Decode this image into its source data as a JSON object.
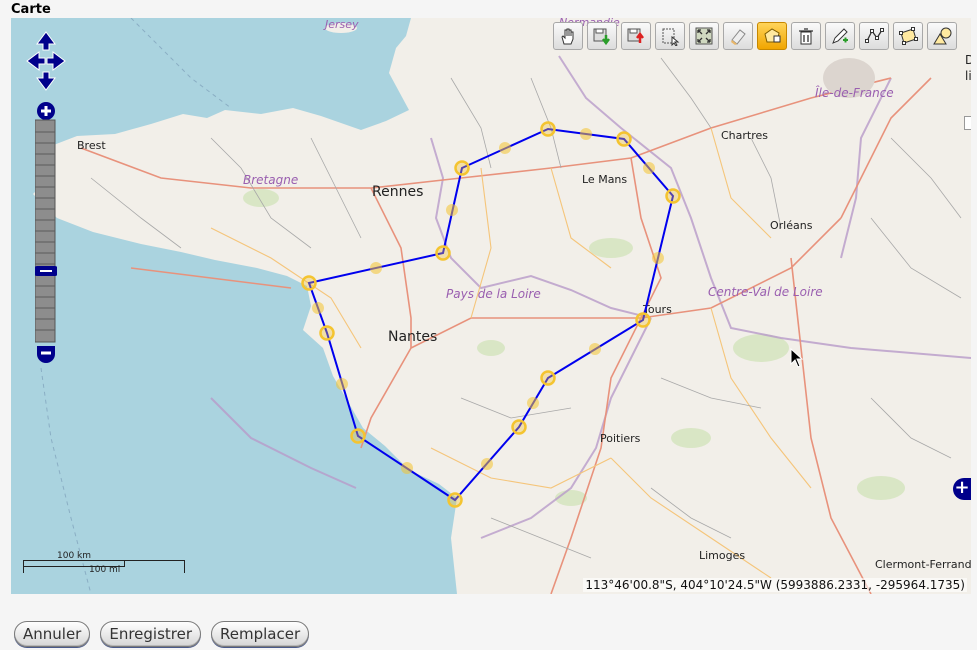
{
  "title": "Carte",
  "map": {
    "places": {
      "jersey": "Jersey",
      "normandie": "Normandie",
      "brest": "Brest",
      "bretagne": "Bretagne",
      "rennes": "Rennes",
      "le_mans": "Le Mans",
      "chartres": "Chartres",
      "ile_de_france": "Île-de-France",
      "orleans": "Orléans",
      "pays_de_la_loire": "Pays de la Loire",
      "centre_val_de_loire": "Centre-Val de Loire",
      "tours": "Tours",
      "nantes": "Nantes",
      "poitiers": "Poitiers",
      "limoges": "Limoges",
      "clermont_ferrand": "Clermont-Ferrand"
    },
    "polygon_color": "#0000ee",
    "vertex_color": "#f4c430",
    "sea_color": "#aad3df",
    "land_color": "#f2efe9"
  },
  "scale": {
    "km_label": "100 km",
    "mi_label": "100 mi"
  },
  "mouse_position": "113°46'00.8\"S, 404°10'24.5\"W (5993886.2331, -295964.1735)",
  "side_legend": {
    "line1": "De",
    "line2": "li"
  },
  "toolbar": {
    "tools": [
      {
        "name": "pan",
        "icon": "hand-icon",
        "active": false
      },
      {
        "name": "save",
        "icon": "save-download-icon",
        "active": false
      },
      {
        "name": "upload",
        "icon": "upload-icon",
        "active": false
      },
      {
        "name": "select",
        "icon": "select-icon",
        "active": false
      },
      {
        "name": "zoom-extent",
        "icon": "zoom-extent-icon",
        "active": false
      },
      {
        "name": "erase",
        "icon": "eraser-icon",
        "active": false
      },
      {
        "name": "modify",
        "icon": "modify-feature-icon",
        "active": true
      },
      {
        "name": "delete",
        "icon": "trash-icon",
        "active": false
      },
      {
        "name": "draw-point",
        "icon": "pencil-icon",
        "active": false
      },
      {
        "name": "draw-line",
        "icon": "line-icon",
        "active": false
      },
      {
        "name": "draw-polygon",
        "icon": "polygon-icon",
        "active": false
      },
      {
        "name": "draw-shape",
        "icon": "shape-icon",
        "active": false
      }
    ]
  },
  "buttons": {
    "cancel": "Annuler",
    "save": "Enregistrer",
    "replace": "Remplacer"
  }
}
